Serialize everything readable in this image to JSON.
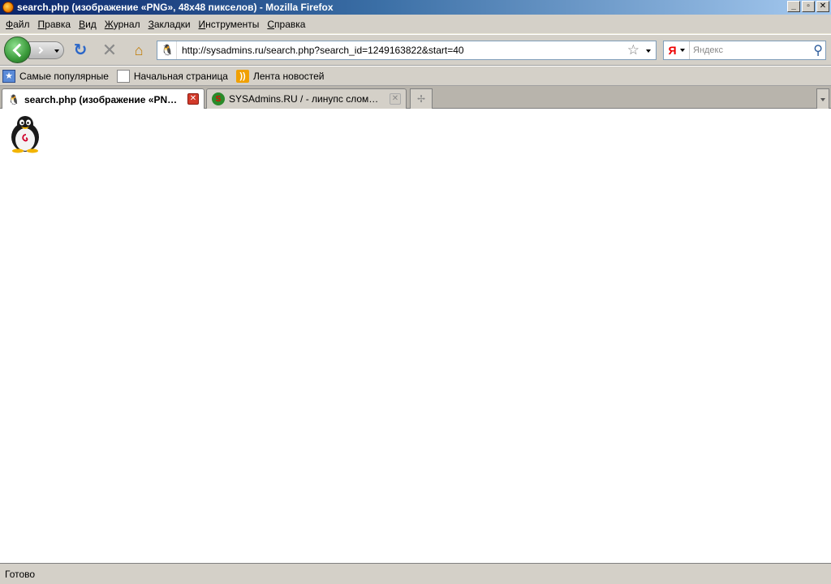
{
  "window": {
    "title": "search.php (изображение «PNG», 48x48 пикселов) - Mozilla Firefox",
    "controls": {
      "minimize": "_",
      "maximize": "▫",
      "close": "✕"
    }
  },
  "menu": [
    {
      "first": "Ф",
      "rest": "айл"
    },
    {
      "first": "П",
      "rest": "равка"
    },
    {
      "first": "В",
      "rest": "ид"
    },
    {
      "first": "Ж",
      "rest": "урнал"
    },
    {
      "first": "З",
      "rest": "акладки"
    },
    {
      "first": "И",
      "rest": "нструменты"
    },
    {
      "first": "С",
      "rest": "правка"
    }
  ],
  "navigation": {
    "url": "http://sysadmins.ru/search.php?search_id=1249163822&start=40",
    "search_engine": "Я",
    "search_placeholder": "Яндекс"
  },
  "bookmarks": [
    {
      "label": "Самые популярные",
      "icon": "popular-icon"
    },
    {
      "label": "Начальная страница",
      "icon": "page-icon"
    },
    {
      "label": "Лента новостей",
      "icon": "rss-icon"
    }
  ],
  "tabs": [
    {
      "label": "search.php (изображение «PNG...",
      "active": true,
      "icon": "penguin-icon"
    },
    {
      "label": "SYSAdmins.RU / - линупс сломал фору...",
      "active": false,
      "icon": "sysadmins-icon"
    }
  ],
  "content": {
    "image_name": "debian-penguin-image"
  },
  "status": {
    "text": "Готово"
  },
  "colors": {
    "chrome": "#d4d0c8",
    "titlebar": "#0a246a",
    "tab_close_active": "#d23a2a"
  }
}
